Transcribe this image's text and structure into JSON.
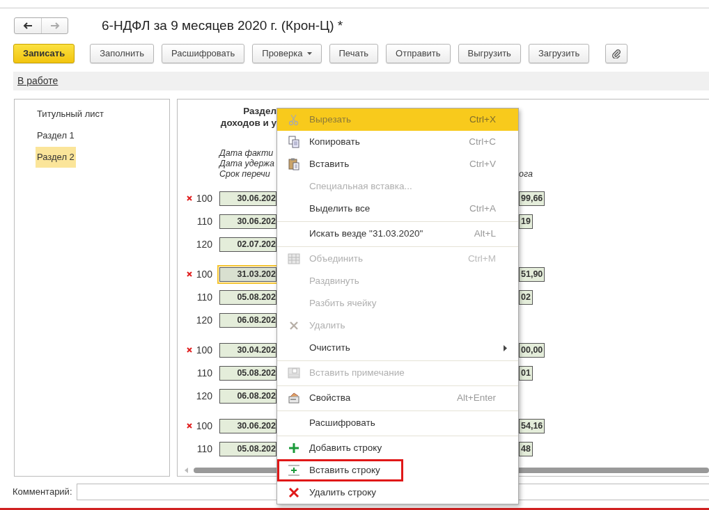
{
  "title": "6-НДФЛ за 9 месяцев 2020 г. (Крон-Ц) *",
  "toolbar": [
    {
      "label": "Записать",
      "kind": "primary"
    },
    {
      "label": "Заполнить",
      "kind": "button"
    },
    {
      "label": "Расшифровать",
      "kind": "button"
    },
    {
      "label": "Проверка",
      "kind": "dropdown"
    },
    {
      "label": "Печать",
      "kind": "button"
    },
    {
      "label": "Отправить",
      "kind": "button"
    },
    {
      "label": "Выгрузить",
      "kind": "button"
    },
    {
      "label": "Загрузить",
      "kind": "button"
    },
    {
      "kind": "attach"
    }
  ],
  "status_link": "В работе",
  "sidebar": {
    "items": [
      {
        "label": "Титульный лист",
        "selected": false
      },
      {
        "label": "Раздел 1",
        "selected": false
      },
      {
        "label": "Раздел 2",
        "selected": true
      }
    ]
  },
  "document": {
    "heading": [
      "Раздел",
      "доходов и у"
    ],
    "legend": [
      {
        "text": "Дата факти"
      },
      {
        "text": "Дата удержа"
      },
      {
        "text": "Срок перечи",
        "right": "ога"
      }
    ],
    "groups": [
      [
        {
          "error": true,
          "code": "100",
          "date": "30.06.202",
          "amount": "99,66",
          "selected": false
        },
        {
          "error": false,
          "code": "110",
          "date": "30.06.202",
          "amount": "19",
          "selected": false
        },
        {
          "error": false,
          "code": "120",
          "date": "02.07.202",
          "selected": false
        }
      ],
      [
        {
          "error": true,
          "code": "100",
          "date": "31.03.202",
          "amount": "51,90",
          "selected": true
        },
        {
          "error": false,
          "code": "110",
          "date": "05.08.202",
          "amount": "02",
          "selected": false
        },
        {
          "error": false,
          "code": "120",
          "date": "06.08.202",
          "selected": false
        }
      ],
      [
        {
          "error": true,
          "code": "100",
          "date": "30.04.202",
          "amount": "00,00",
          "selected": false
        },
        {
          "error": false,
          "code": "110",
          "date": "05.08.202",
          "amount": "01",
          "selected": false
        },
        {
          "error": false,
          "code": "120",
          "date": "06.08.202",
          "selected": false
        }
      ],
      [
        {
          "error": true,
          "code": "100",
          "date": "30.06.202",
          "amount": "54,16",
          "selected": false
        },
        {
          "error": false,
          "code": "110",
          "date": "05.08.202",
          "amount": "48",
          "selected": false
        }
      ]
    ]
  },
  "context_menu": {
    "items": [
      {
        "kind": "item",
        "label": "Вырезать",
        "shortcut": "Ctrl+X",
        "disabled": true,
        "selected": true
      },
      {
        "kind": "item",
        "label": "Копировать",
        "shortcut": "Ctrl+C",
        "disabled": false,
        "selected": false
      },
      {
        "kind": "item",
        "label": "Вставить",
        "shortcut": "Ctrl+V",
        "disabled": false,
        "selected": false
      },
      {
        "kind": "item",
        "label": "Специальная вставка...",
        "disabled": true,
        "selected": false
      },
      {
        "kind": "item",
        "label": "Выделить все",
        "shortcut": "Ctrl+A",
        "disabled": false,
        "selected": false
      },
      {
        "kind": "separator"
      },
      {
        "kind": "item",
        "label": "Искать везде \"31.03.2020\"",
        "shortcut": "Alt+L",
        "disabled": false,
        "selected": false
      },
      {
        "kind": "separator"
      },
      {
        "kind": "item",
        "label": "Объединить",
        "shortcut": "Ctrl+M",
        "disabled": true,
        "selected": false
      },
      {
        "kind": "item",
        "label": "Раздвинуть",
        "disabled": true,
        "selected": false
      },
      {
        "kind": "item",
        "label": "Разбить ячейку",
        "disabled": true,
        "selected": false
      },
      {
        "kind": "item",
        "label": "Удалить",
        "disabled": true,
        "selected": false
      },
      {
        "kind": "submenu",
        "label": "Очистить",
        "disabled": false,
        "selected": false
      },
      {
        "kind": "separator"
      },
      {
        "kind": "item",
        "label": "Вставить примечание",
        "disabled": true,
        "selected": false
      },
      {
        "kind": "separator"
      },
      {
        "kind": "item",
        "label": "Свойства",
        "shortcut": "Alt+Enter",
        "disabled": false,
        "selected": false
      },
      {
        "kind": "separator"
      },
      {
        "kind": "item",
        "label": "Расшифровать",
        "disabled": false,
        "selected": false
      },
      {
        "kind": "separator"
      },
      {
        "kind": "item",
        "label": "Добавить строку",
        "disabled": false,
        "selected": false
      },
      {
        "kind": "item",
        "label": "Вставить строку",
        "disabled": false,
        "selected": false,
        "highlighted": true
      },
      {
        "kind": "item",
        "label": "Удалить строку",
        "disabled": false,
        "selected": false
      }
    ]
  },
  "comment": {
    "label": "Комментарий:"
  }
}
